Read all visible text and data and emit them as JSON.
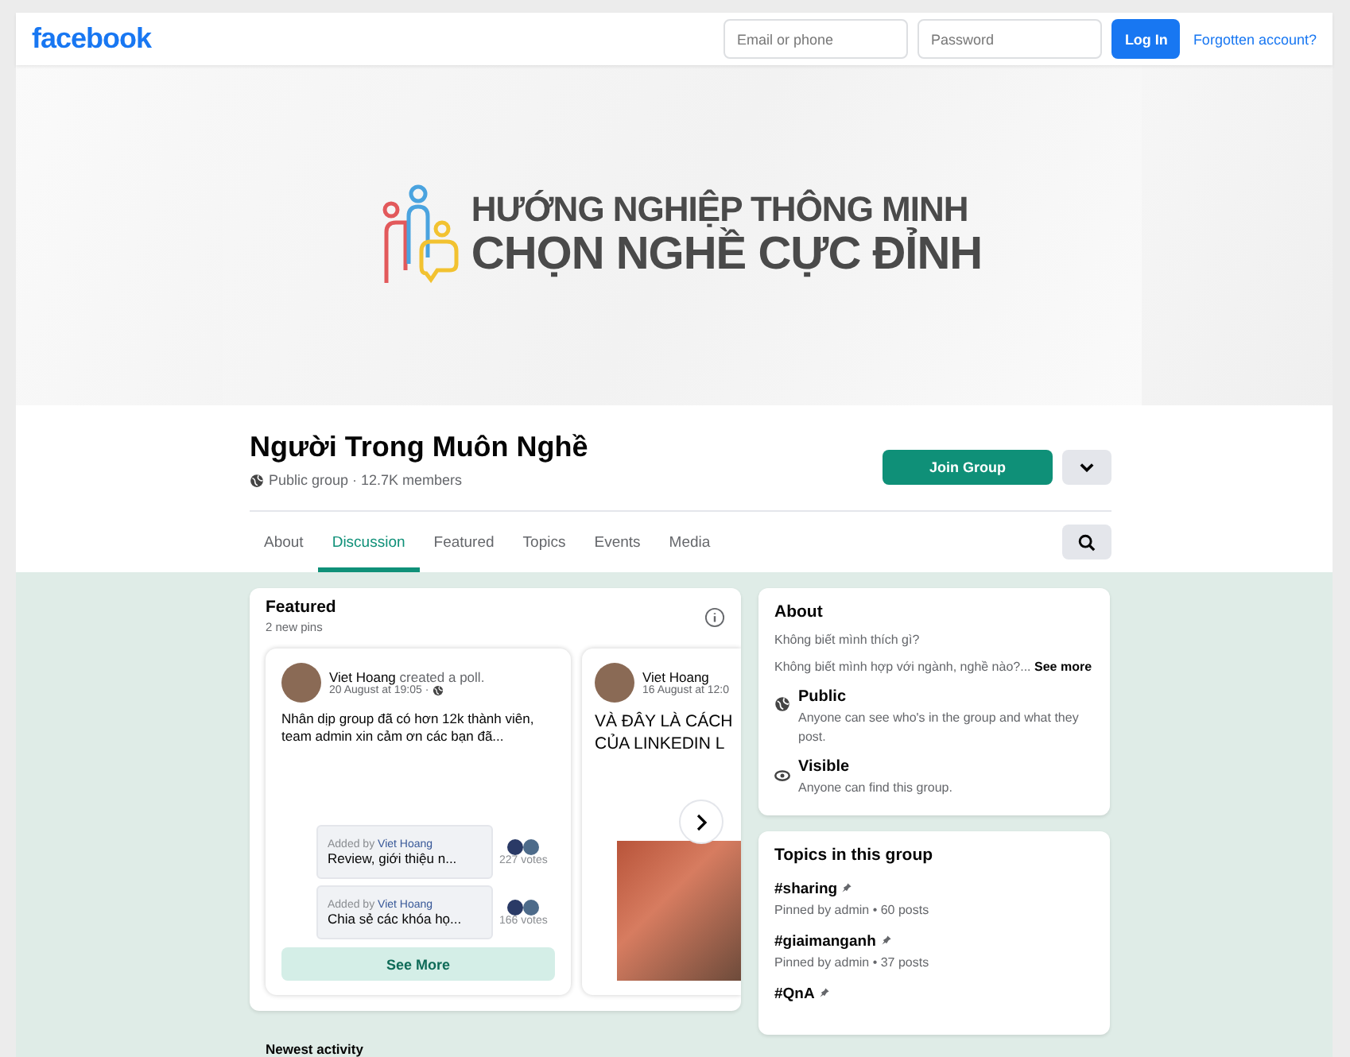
{
  "topbar": {
    "logo": "facebook",
    "email": {
      "placeholder": "Email or phone"
    },
    "password": {
      "placeholder": "Password"
    },
    "login": "Log In",
    "forgot": "Forgotten account?"
  },
  "cover": {
    "lines": [
      "HƯỚNG NGHIỆP THÔNG MINH",
      "CHỌN NGHỀ CỰC ĐỈNH"
    ]
  },
  "group": {
    "name": "Người Trong Muôn Nghề",
    "meta": "Public group · 12.7K members",
    "join": "Join Group"
  },
  "tabs": [
    {
      "label": "About",
      "selected": false
    },
    {
      "label": "Discussion",
      "selected": true
    },
    {
      "label": "Featured",
      "selected": false
    },
    {
      "label": "Topics",
      "selected": false
    },
    {
      "label": "Events",
      "selected": false
    },
    {
      "label": "Media",
      "selected": false
    }
  ],
  "featured": {
    "title": "Featured",
    "subtitle": "2 new pins",
    "posts": [
      {
        "kind": "poll",
        "author": "Viet Hoang",
        "action": "created a poll.",
        "time": "20 August at 19:05 ·",
        "text": "Nhân dịp group đã có hơn 12k thành viên, team admin xin cảm ơn các bạn đã...",
        "options": [
          {
            "added_by": "Added by",
            "adder": "Viet Hoang",
            "label": "Review, giới thiệu n...",
            "votes": "227 votes"
          },
          {
            "added_by": "Added by",
            "adder": "Viet Hoang",
            "label": "Chia sẻ các khóa họ...",
            "votes": "166 votes"
          }
        ],
        "button": "See More"
      },
      {
        "kind": "photo",
        "author": "Viet Hoang",
        "time": "16 August at 12:0",
        "lines": [
          "VÀ ĐÂY LÀ CÁCH",
          "CỦA LINKEDIN L"
        ]
      }
    ]
  },
  "newest": "Newest activity",
  "about": {
    "title": "About",
    "lines": [
      "Không biết mình thích gì?",
      "Không biết mình hợp với ngành, nghề nào?... **See more**"
    ],
    "items": [
      {
        "kind": "public",
        "title": "Public",
        "text": "Anyone can see who's in the group and what they post."
      },
      {
        "kind": "visible",
        "title": "Visible",
        "text": "Anyone can find this group."
      }
    ]
  },
  "topics": {
    "title": "Topics in this group",
    "items": [
      {
        "tag": "#sharing",
        "meta": "Pinned by admin • 60 posts"
      },
      {
        "tag": "#giaimanganh",
        "meta": "Pinned by admin • 37 posts"
      },
      {
        "tag": "#QnA"
      }
    ]
  }
}
